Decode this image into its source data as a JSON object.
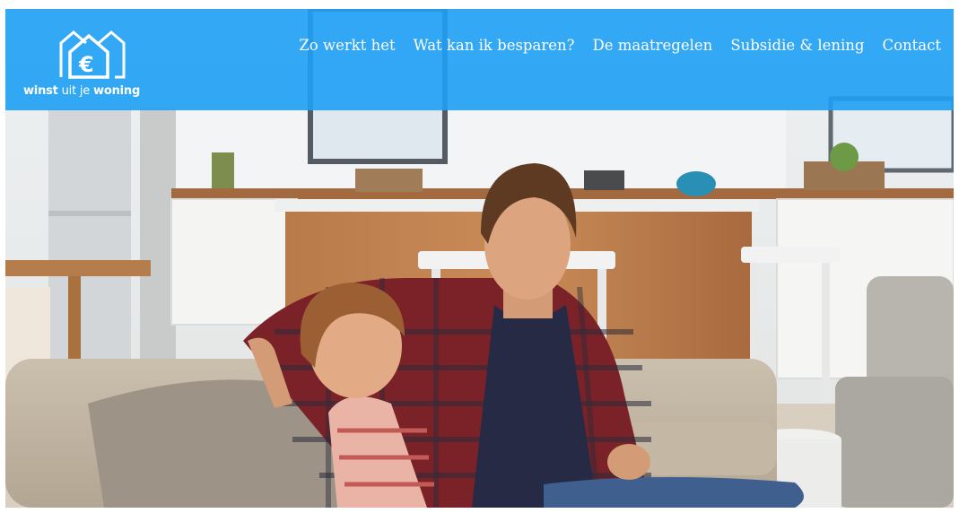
{
  "logo": {
    "part1": "winst",
    "part2": " uit je ",
    "part3": "woning",
    "icon": "house-euro-icon"
  },
  "nav": {
    "items": [
      {
        "label": "Zo werkt het"
      },
      {
        "label": "Wat kan ik besparen?"
      },
      {
        "label": "De maatregelen"
      },
      {
        "label": "Subsidie & lening"
      },
      {
        "label": "Contact"
      }
    ]
  },
  "colors": {
    "header": "#1ea0f5",
    "text": "#ffffff"
  }
}
